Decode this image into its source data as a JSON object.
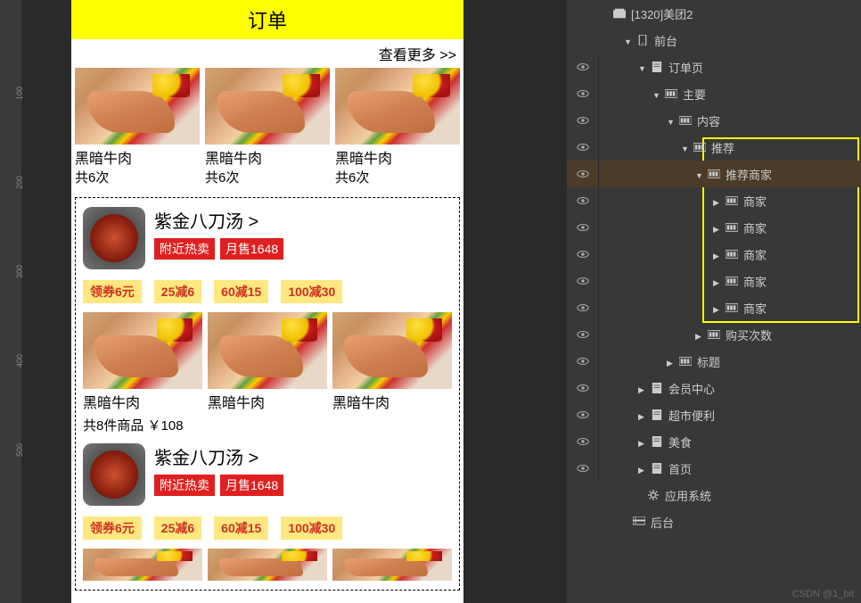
{
  "header": {
    "title": "订单"
  },
  "view_more": "查看更多 >>",
  "food_items": [
    {
      "name": "黑暗牛肉",
      "count": "共6次"
    },
    {
      "name": "黑暗牛肉",
      "count": "共6次"
    },
    {
      "name": "黑暗牛肉",
      "count": "共6次"
    }
  ],
  "merchant1": {
    "title": "紫金八刀汤 >",
    "badge1": "附近热卖",
    "badge2": "月售1648",
    "promos": [
      "领券6元",
      "25减6",
      "60减15",
      "100减30"
    ]
  },
  "food_items2": [
    {
      "name": "黑暗牛肉"
    },
    {
      "name": "黑暗牛肉"
    },
    {
      "name": "黑暗牛肉"
    }
  ],
  "order_summary": "共8件商品 ￥108",
  "merchant2": {
    "title": "紫金八刀汤 >",
    "badge1": "附近热卖",
    "badge2": "月售1648",
    "promos": [
      "领券6元",
      "25减6",
      "60减15",
      "100减30"
    ]
  },
  "ruler_ticks": [
    "100",
    "200",
    "300",
    "400",
    "500"
  ],
  "tree": {
    "root": "[1320]美团2",
    "l1": "前台",
    "l2": "订单页",
    "l3": "主要",
    "l4": "内容",
    "l5": "推荐",
    "l6": "推荐商家",
    "merchants": [
      "商家",
      "商家",
      "商家",
      "商家",
      "商家"
    ],
    "purchase_count": "购买次数",
    "title": "标题",
    "pages": [
      "会员中心",
      "超市便利",
      "美食",
      "首页"
    ],
    "app_system": "应用系统",
    "backend": "后台"
  },
  "watermark": "CSDN @1_bit"
}
